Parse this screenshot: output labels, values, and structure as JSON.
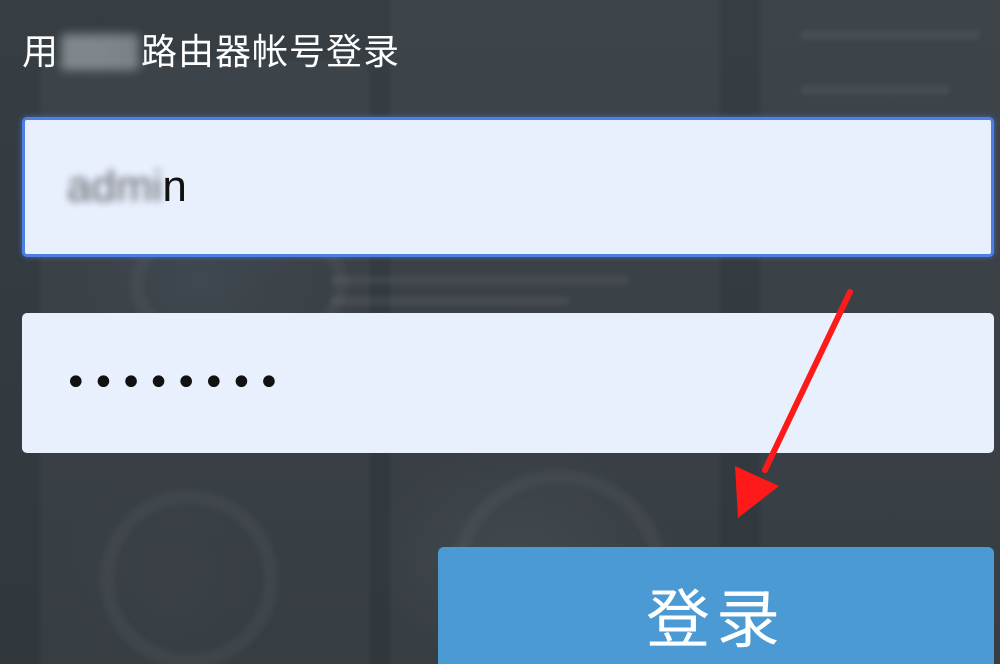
{
  "page": {
    "title_prefix": "用",
    "title_suffix": "路由器帐号登录"
  },
  "form": {
    "username_visible": "n",
    "username_redacted": "admi",
    "password_mask": "••••••••",
    "login_label": "登录"
  },
  "colors": {
    "background": "#323a40",
    "field_bg": "#e8f0fe",
    "focus_border": "#4d7fe5",
    "button_bg": "#4c9ad3",
    "arrow": "#ff1a1a"
  },
  "annotation": {
    "type": "red-arrow",
    "points_to": "login-button"
  }
}
